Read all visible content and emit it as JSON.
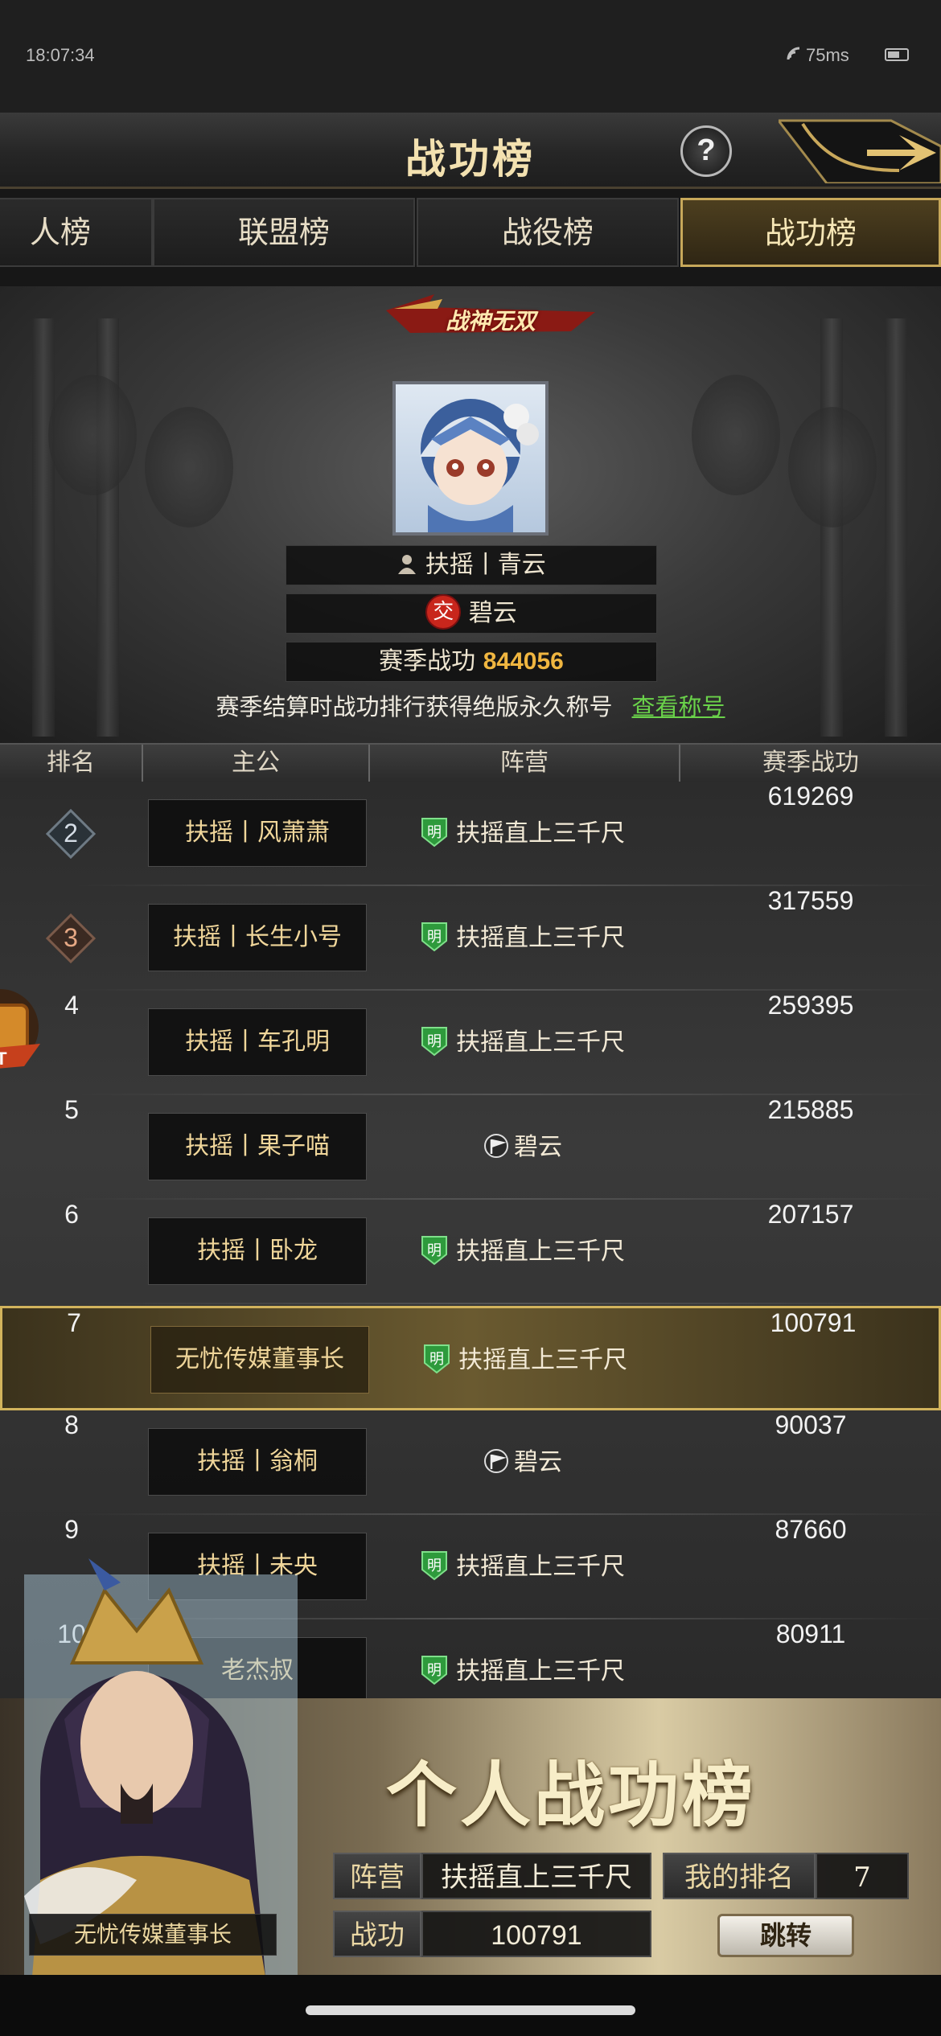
{
  "status": {
    "time": "18:07:34",
    "ping": "75ms"
  },
  "header": {
    "title": "战功榜"
  },
  "tabs": [
    {
      "label": "人榜",
      "active": false
    },
    {
      "label": "联盟榜",
      "active": false
    },
    {
      "label": "战役榜",
      "active": false
    },
    {
      "label": "战功榜",
      "active": true
    }
  ],
  "champion": {
    "banner": "战神无双",
    "name": "扶摇丨青云",
    "camp_badge": "交",
    "camp": "碧云",
    "season_label": "赛季战功",
    "season_value": "844056"
  },
  "notice": {
    "text": "赛季结算时战功排行获得绝版永久称号",
    "link": "查看称号"
  },
  "table": {
    "headers": {
      "rank": "排名",
      "lord": "主公",
      "camp": "阵营",
      "score": "赛季战功"
    },
    "rows": [
      {
        "rank": "2",
        "name": "扶摇丨风萧萧",
        "camp": "扶摇直上三千尺",
        "camp_icon": "ming-shield",
        "score": "619269"
      },
      {
        "rank": "3",
        "name": "扶摇丨长生小号",
        "camp": "扶摇直上三千尺",
        "camp_icon": "ming-shield",
        "score": "317559"
      },
      {
        "rank": "4",
        "name": "扶摇丨车孔明",
        "camp": "扶摇直上三千尺",
        "camp_icon": "ming-shield",
        "score": "259395"
      },
      {
        "rank": "5",
        "name": "扶摇丨果子喵",
        "camp": "碧云",
        "camp_icon": "flag",
        "score": "215885"
      },
      {
        "rank": "6",
        "name": "扶摇丨卧龙",
        "camp": "扶摇直上三千尺",
        "camp_icon": "ming-shield",
        "score": "207157"
      },
      {
        "rank": "7",
        "name": "无忧传媒董事长",
        "camp": "扶摇直上三千尺",
        "camp_icon": "ming-shield",
        "score": "100791",
        "highlight": true
      },
      {
        "rank": "8",
        "name": "扶摇丨翁桐",
        "camp": "碧云",
        "camp_icon": "flag",
        "score": "90037"
      },
      {
        "rank": "9",
        "name": "扶摇丨未央",
        "camp": "扶摇直上三千尺",
        "camp_icon": "ming-shield",
        "score": "87660"
      },
      {
        "rank": "10",
        "name": "老杰叔",
        "camp": "扶摇直上三千尺",
        "camp_icon": "ming-shield",
        "score": "80911"
      }
    ],
    "ming_glyph": "明"
  },
  "panel": {
    "title": "个人战功榜",
    "camp_label": "阵营",
    "camp_value": "扶摇直上三千尺",
    "rank_label": "我的排名",
    "rank_value": "7",
    "score_label": "战功",
    "score_value": "100791",
    "jump_label": "跳转",
    "player_name": "无忧传媒董事长"
  },
  "side_badge": "OT",
  "colors": {
    "gold": "#d2b35c",
    "score": "#f0b640",
    "link": "#6ad24a",
    "shield": "#2e9a3c"
  }
}
